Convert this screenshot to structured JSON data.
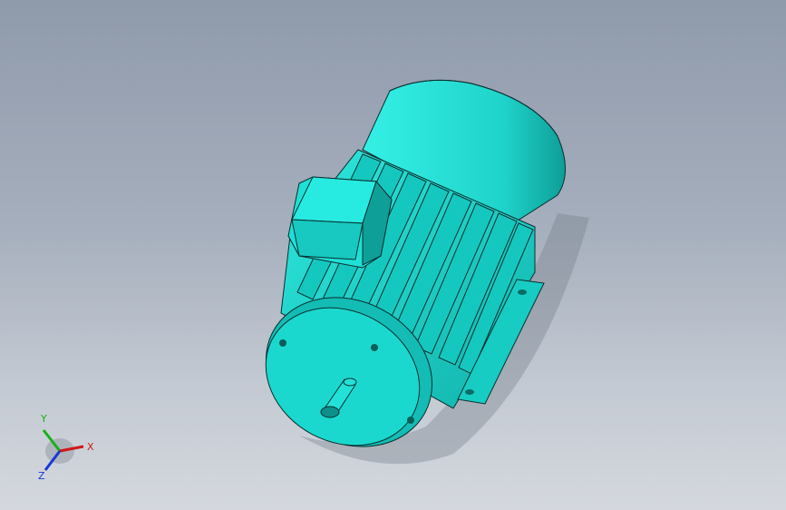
{
  "viewport": {
    "model": "electric-motor",
    "colors": {
      "background_top": "#8f9aab",
      "background_bottom": "#d4d8de",
      "body": "#19d6cc",
      "body_shadow": "#0f9f99",
      "edge": "#0a2f2f"
    }
  },
  "triad": {
    "x_label": "X",
    "y_label": "Y",
    "z_label": "Z",
    "colors": {
      "x": "#d01818",
      "y": "#18b018",
      "z": "#1838d8"
    }
  }
}
